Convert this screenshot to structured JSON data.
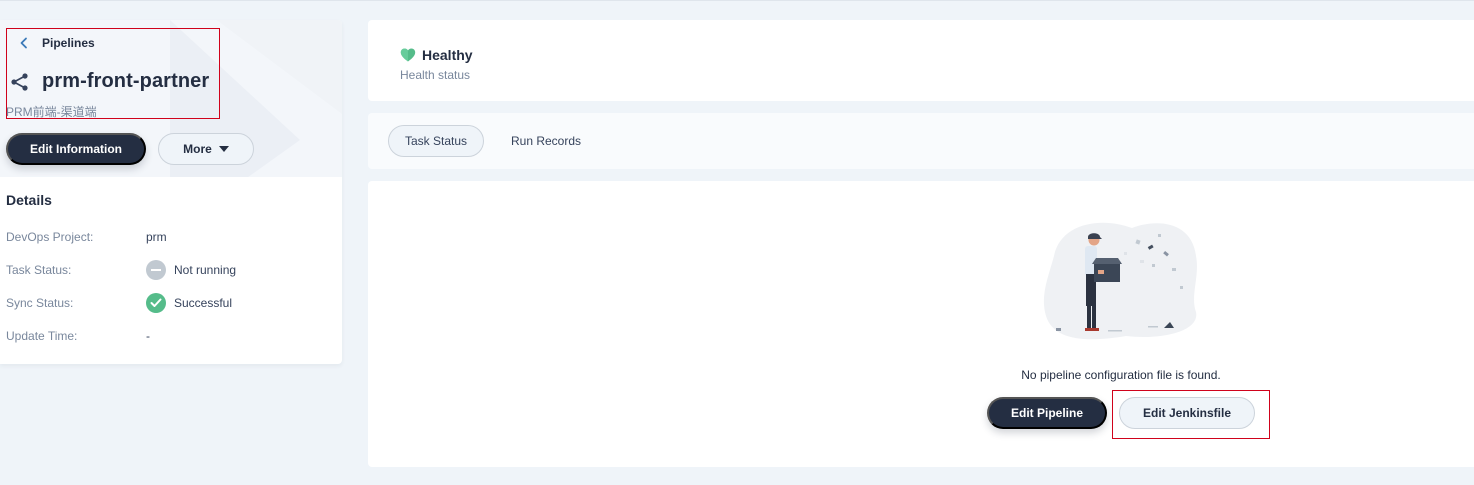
{
  "breadcrumb": {
    "back_label": "Pipelines"
  },
  "pipeline": {
    "name": "prm-front-partner",
    "description": "PRM前端-渠道端"
  },
  "actions": {
    "edit_info_label": "Edit Information",
    "more_label": "More"
  },
  "details": {
    "title": "Details",
    "rows": [
      {
        "key": "DevOps Project:",
        "value": "prm"
      },
      {
        "key": "Task Status:",
        "value": "Not running"
      },
      {
        "key": "Sync Status:",
        "value": "Successful"
      },
      {
        "key": "Update Time:",
        "value": "-"
      }
    ]
  },
  "health": {
    "status": "Healthy",
    "label": "Health status"
  },
  "tabs": [
    {
      "label": "Task Status",
      "active": true
    },
    {
      "label": "Run Records",
      "active": false
    }
  ],
  "empty_state": {
    "message": "No pipeline configuration file is found.",
    "edit_pipeline_label": "Edit Pipeline",
    "edit_jenkinsfile_label": "Edit Jenkinsfile"
  },
  "colors": {
    "dark": "#242e42",
    "success": "#55bc8a",
    "neutral_status": "#c1c9d1",
    "health": "#55bc8a",
    "annotation": "#d0021b"
  },
  "icons": {
    "back": "chevron-left-icon",
    "pipeline": "pipeline-icon",
    "more_caret": "caret-down-icon",
    "health": "heart-icon",
    "task_status": "minus-circle-icon",
    "sync_status": "check-circle-icon"
  }
}
